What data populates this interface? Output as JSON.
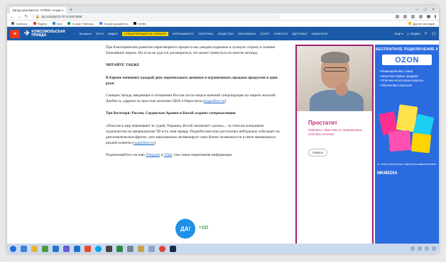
{
  "browser": {
    "tab_title": "Запад увлекается «ОПЕК» когда п…",
    "tab_close": "×",
    "new_tab": "+",
    "window_controls": [
      "–",
      "□",
      "×"
    ],
    "url": "kp.ru/daily/217371/4307809/",
    "bookmarks": [
      "Сервисы",
      "Яндекс",
      "Mail",
      "Google Таблицы",
      "Google Документы",
      "Netflix"
    ],
    "bookmarks_right": "Другие закладки"
  },
  "site": {
    "logo_line1": "КОМСОМОЛЬСКАЯ",
    "logo_line2": "ПРАВДА",
    "region": "Москва ▾",
    "nav": [
      "ФОТО",
      "ВИДЕО",
      "СПЕЦОПЕРАЦИЯ НА УКРАИНЕ",
      "КОРОНАВИРУС",
      "ПОЛИТИКА",
      "ОБЩЕСТВО",
      "ЭКОНОМИКА",
      "СПОРТ",
      "НОВОСТИ",
      "ЗДОРОВЬЕ",
      "НАВИГАТОР"
    ],
    "highlight_index": 2,
    "hdr_more": "ЕЩЕ ▾",
    "hdr_radio": "РАДИО"
  },
  "article": {
    "p1": "При благоприятном развитии переговорного процесса мы увидим подвижки в лучшую сторону в течение ближайших недель. Но если не удастся договориться, это может затянуться на многие месяцы.",
    "read_also": "ЧИТАЙТЕ ТАКЖЕ",
    "h1": "В Европе начинают каждый день переписывать ценники и ограничивать продажи продуктов в одни руки",
    "p2_a": "Санкции Запада, введенные в отношении России после начала военной спецоперации по защите жителей Донбасса, ударили по простым жителям США и Евросоюза (",
    "p2_link": "подробности",
    "p2_b": ")",
    "h2": "Три богатыря: Россия, Саудовская Аравия и Китай создают суперкоалицию",
    "p3_a": "«Пока весь мир переживает за судьбу Украины, Китай заключает сделки», - за этим восклицанием журналистки на американском ТВ есть своя правда. Поднебесная пока достаточно нейтрально себя ведет на дипломатическом фронте, зато максимально активизирует свои бизнес-возможности в свете меняющихся реалий планеты (",
    "p3_link": "подробности",
    "p3_b": ")",
    "p4_a": "Подписывайтесь на наш ",
    "p4_link1": "Telegram",
    "p4_mid": " и ",
    "p4_link2": "Viber",
    "p4_b": ", там самая оперативная информация.",
    "share_label": "ДА!",
    "share_count": "+121"
  },
  "ad": {
    "title": "Простатит",
    "desc": "Причины, симптомы и современные способы лечения",
    "button": "Узнать!"
  },
  "ozon": {
    "top": "БЕСПЛАТНОЕ ПОДКЛЮЧЕНИЕ К",
    "logo": "OZON",
    "items": [
      "Размещаем ваш товар",
      "Запустим первые продажи",
      "Ответим на все ваши вопросы",
      "Обучим ваш персонал"
    ],
    "foot": "от технологического партнера маркетплейса",
    "brand": "MKMEDIA"
  }
}
